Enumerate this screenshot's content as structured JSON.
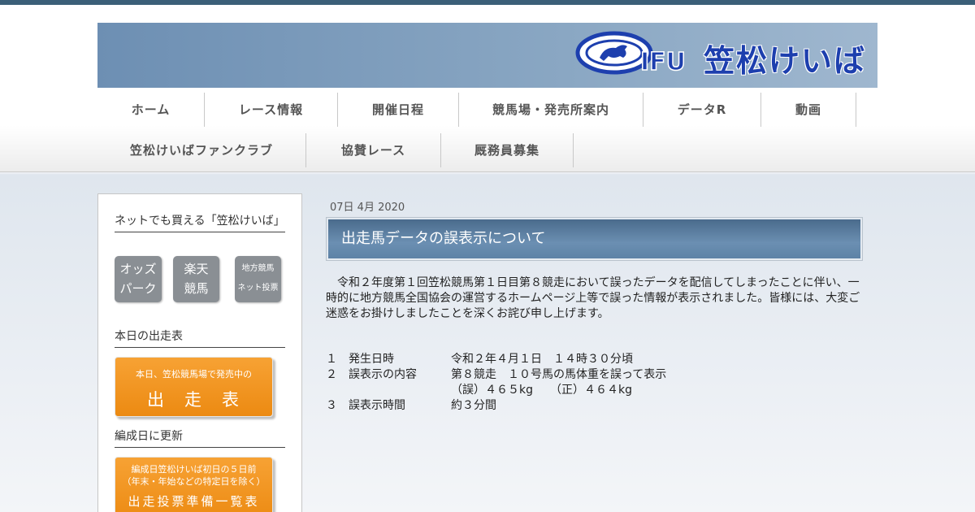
{
  "header": {
    "logo_text": "GIFU 笠松けいば",
    "logo_alt": "GIFU 笠松けいば"
  },
  "nav": {
    "row1": [
      "ホーム",
      "レース情報",
      "開催日程",
      "競馬場・発売所案内",
      "データR",
      "動画"
    ],
    "row2": [
      "笠松けいばファンクラブ",
      "協賛レース",
      "厩務員募集"
    ]
  },
  "sidebar": {
    "section1_title": "ネットでも買える「笠松けいば」",
    "buttons": [
      {
        "line1": "オッズ",
        "line2": "パーク"
      },
      {
        "line1": "楽天",
        "line2": "競馬"
      },
      {
        "line1": "地方競馬",
        "line2": "ネット投票"
      }
    ],
    "section2_title": "本日の出走表",
    "today_banner": {
      "small": "本日、笠松競馬場で発売中の",
      "big": "出　走　表"
    },
    "section3_title": "編成日に更新",
    "update_banner": {
      "small1": "編成日笠松けいば初日の５日前",
      "small2": "（年末・年始などの特定日を除く）",
      "big": "出走投票準備一覧表"
    }
  },
  "article": {
    "date": "07日 4月 2020",
    "title": "出走馬データの誤表示について",
    "body": "　令和２年度第１回笠松競馬第１日目第８競走において誤ったデータを配信してしまったことに伴い、一時的に地方競馬全国協会の運営するホームページ上等で誤った情報が表示されました。皆様には、大変ご迷惑をお掛けしましたことを深くお詫び申し上げます。",
    "details": [
      {
        "num": "１",
        "label": "発生日時",
        "value": "令和２年４月１日　１４時３０分頃"
      },
      {
        "num": "２",
        "label": "誤表示の内容",
        "value": "第８競走　１０号馬の馬体重を誤って表示"
      },
      {
        "num": "",
        "label": "",
        "value": "（誤）４６５kg　　（正）４６４kg"
      },
      {
        "num": "３",
        "label": "誤表示時間",
        "value": "約３分間"
      }
    ]
  },
  "colors": {
    "topbar": "#3b5f78",
    "title_bar": "#5d82a6",
    "orange": "#f08f16",
    "gray_button": "#8a8f94"
  }
}
